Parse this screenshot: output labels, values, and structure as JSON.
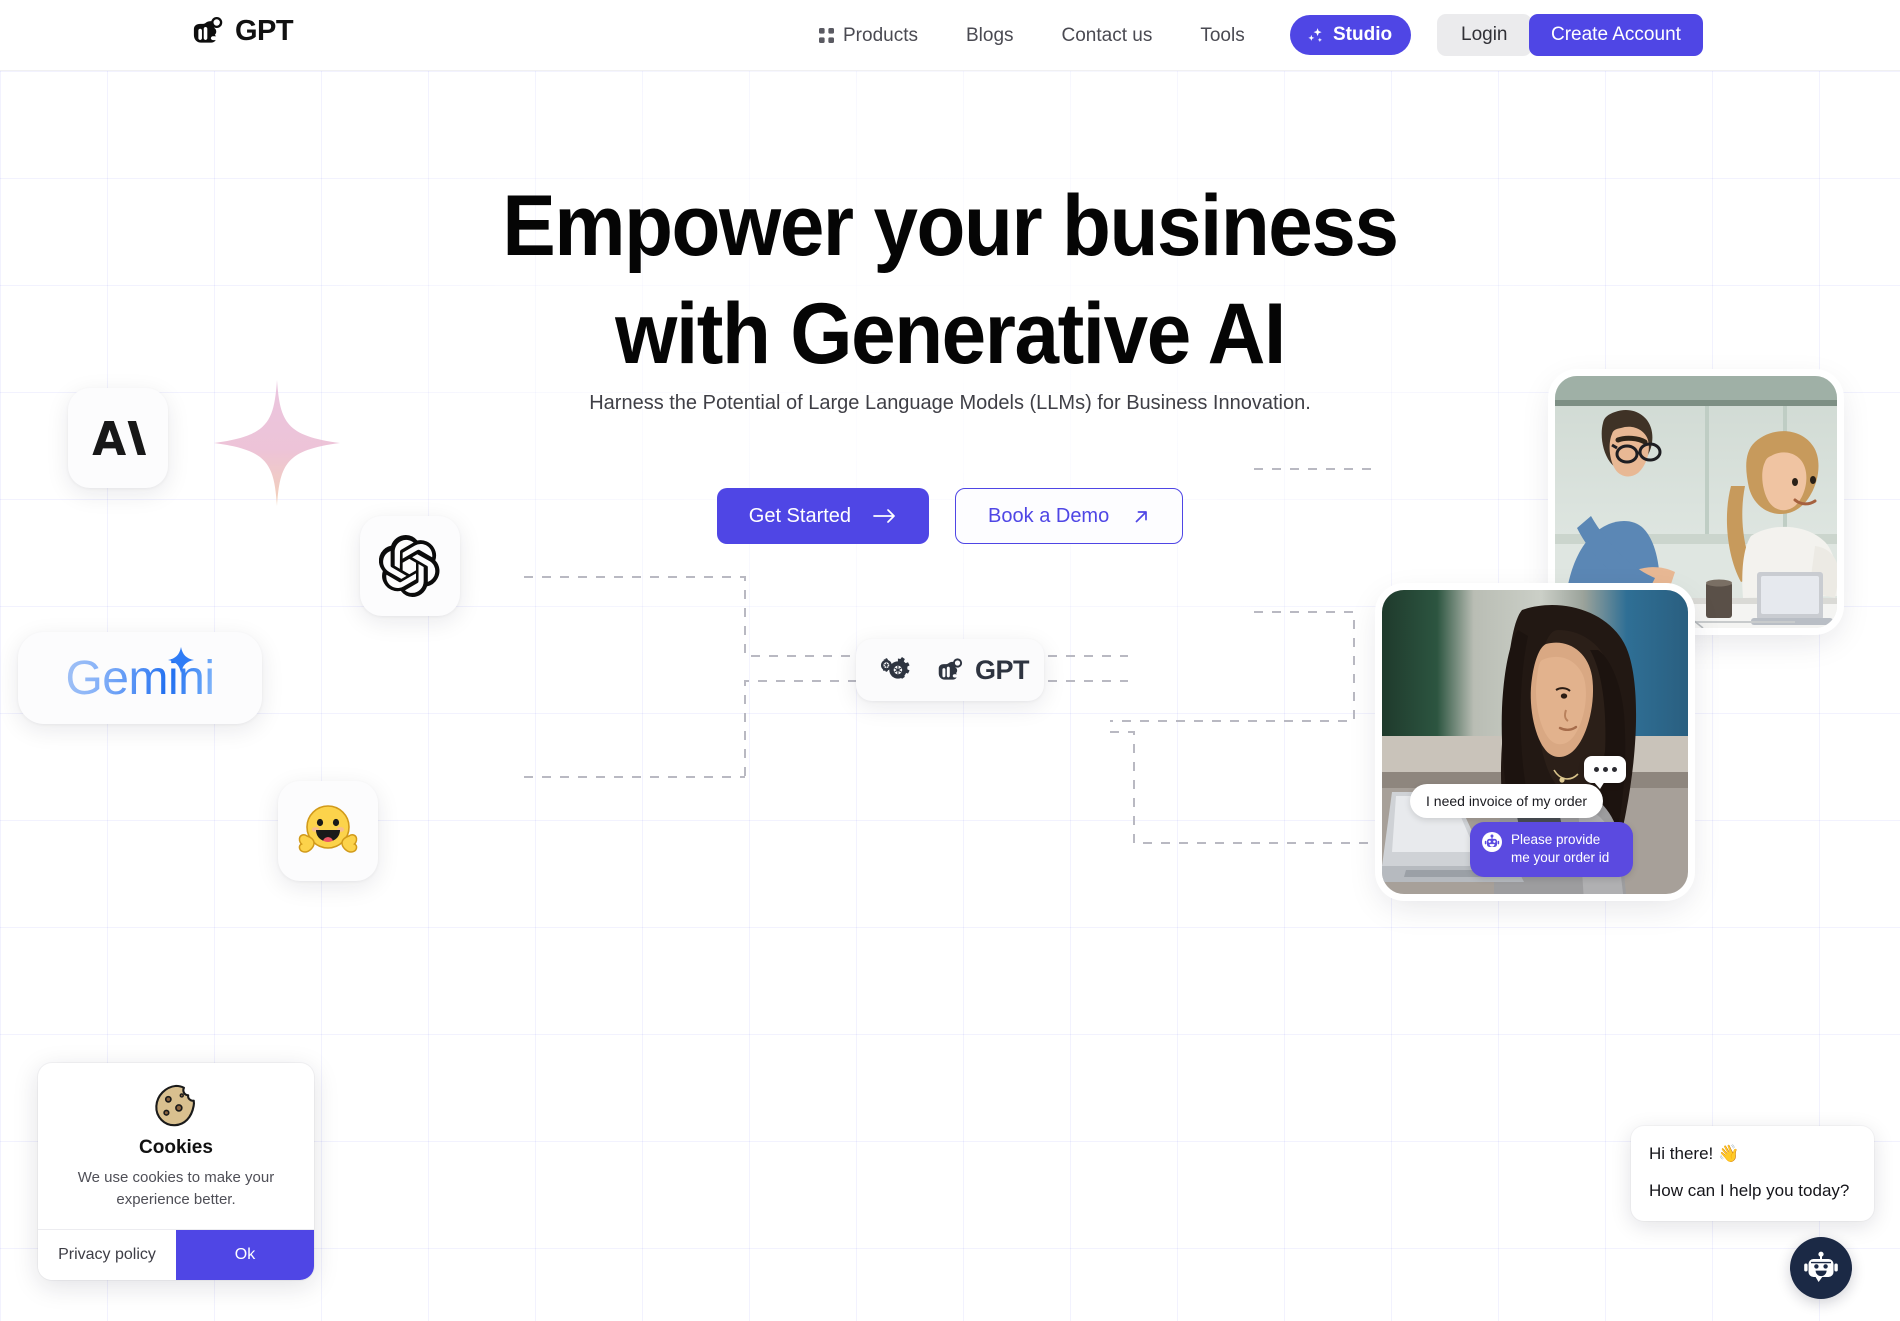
{
  "brand": {
    "name": "GPT",
    "logo_icon": "gpt-hand-logo"
  },
  "nav": {
    "items": [
      {
        "label": "Products",
        "icon": "grid-icon"
      },
      {
        "label": "Blogs",
        "icon": null
      },
      {
        "label": "Contact us",
        "icon": null
      },
      {
        "label": "Tools",
        "icon": null
      }
    ],
    "studio": {
      "label": "Studio",
      "icon": "sparkles-icon",
      "color": "#4f46e5"
    },
    "login": {
      "label": "Login"
    },
    "create_account": {
      "label": "Create Account",
      "color": "#4f46e5"
    }
  },
  "hero": {
    "title_line1": "Empower your business",
    "title_line2": "with Generative AI",
    "subtitle": "Harness the Potential of Large Language Models (LLMs) for Business Innovation.",
    "primary_cta": {
      "label": "Get Started",
      "icon": "arrow-right-icon"
    },
    "secondary_cta": {
      "label": "Book a Demo",
      "icon": "arrow-up-right-icon"
    }
  },
  "logo_cards": [
    {
      "name": "anthropic",
      "icon": "anthropic-logo"
    },
    {
      "name": "openai",
      "icon": "openai-logo"
    },
    {
      "name": "gemini",
      "label": "Gemini",
      "icon": "gemini-sparkle-icon"
    },
    {
      "name": "huggingface",
      "icon": "hugging-face-emoji"
    },
    {
      "name": "center-node",
      "label": "GPT",
      "icon": "gears-icon"
    }
  ],
  "chat_preview": {
    "typing_indicator": "•••",
    "user_message": "I need invoice of my order",
    "bot_message": "Please provide me your order id",
    "bot_icon": "robot-icon",
    "bot_bubble_color": "#5b4ae0"
  },
  "cookies": {
    "icon": "cookie-icon",
    "title": "Cookies",
    "text": "We use cookies to make your experience better.",
    "privacy_label": "Privacy policy",
    "ok_label": "Ok",
    "ok_color": "#4f46e5"
  },
  "chatbot": {
    "greeting": "Hi there! 👋",
    "prompt": "How can I help you today?",
    "fab_icon": "robot-icon",
    "fab_color": "#1b2945"
  }
}
